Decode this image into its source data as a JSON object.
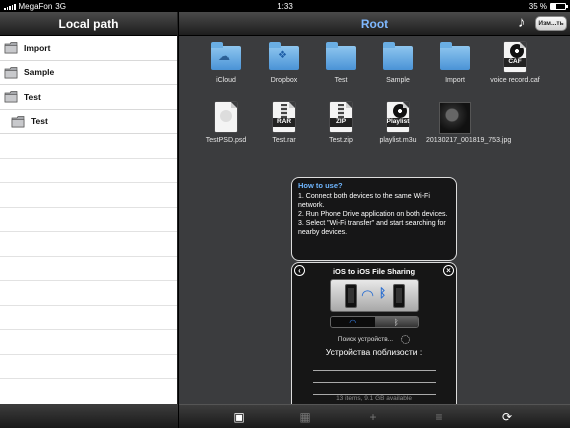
{
  "status_bar": {
    "carrier": "MegaFon",
    "network": "3G",
    "time": "1:33",
    "battery": "35 %",
    "battery_fraction": 0.35
  },
  "left_panel": {
    "title": "Local path",
    "items": [
      {
        "label": "Import",
        "indent": false
      },
      {
        "label": "Sample",
        "indent": false
      },
      {
        "label": "Test",
        "indent": false
      },
      {
        "label": "Test",
        "indent": true
      }
    ]
  },
  "right_panel": {
    "title": "Root",
    "edit_label": "Изм...ть",
    "files": [
      {
        "label": "iCloud",
        "icon": "icloud-folder-icon"
      },
      {
        "label": "Dropbox",
        "icon": "dropbox-folder-icon"
      },
      {
        "label": "Test",
        "icon": "folder-icon"
      },
      {
        "label": "Sample",
        "icon": "folder-icon"
      },
      {
        "label": "Import",
        "icon": "folder-icon"
      },
      {
        "label": "voice record.caf",
        "icon": "caf-file-icon",
        "badge": "CAF"
      },
      {
        "label": "TestPSD.psd",
        "icon": "psd-file-icon"
      },
      {
        "label": "Test.rar",
        "icon": "rar-file-icon",
        "badge": "RAR"
      },
      {
        "label": "Test.zip",
        "icon": "zip-file-icon",
        "badge": "ZIP"
      },
      {
        "label": "playlist.m3u",
        "icon": "playlist-file-icon",
        "badge": "Playlist"
      },
      {
        "label": "20130217_001819_753.jpg",
        "icon": "jpg-thumbnail-icon"
      }
    ]
  },
  "help": {
    "heading": "How to use?",
    "steps": [
      "1. Connect both devices to the same Wi-Fi network.",
      "2. Run Phone Drive application on both devices.",
      "3. Select \"Wi-Fi transfer\" and start searching for nearby devices."
    ]
  },
  "sharing": {
    "title": "iOS to iOS File Sharing",
    "searching_label": "Поиск устройств...",
    "nearby_label": "Устройства поблизости :",
    "storage_text": "13 items, 9.1 GB available"
  },
  "colors": {
    "title_blue": "#7fb8ff",
    "help_heading": "#6fb6ff",
    "folder_blue": "#4a93d6"
  }
}
